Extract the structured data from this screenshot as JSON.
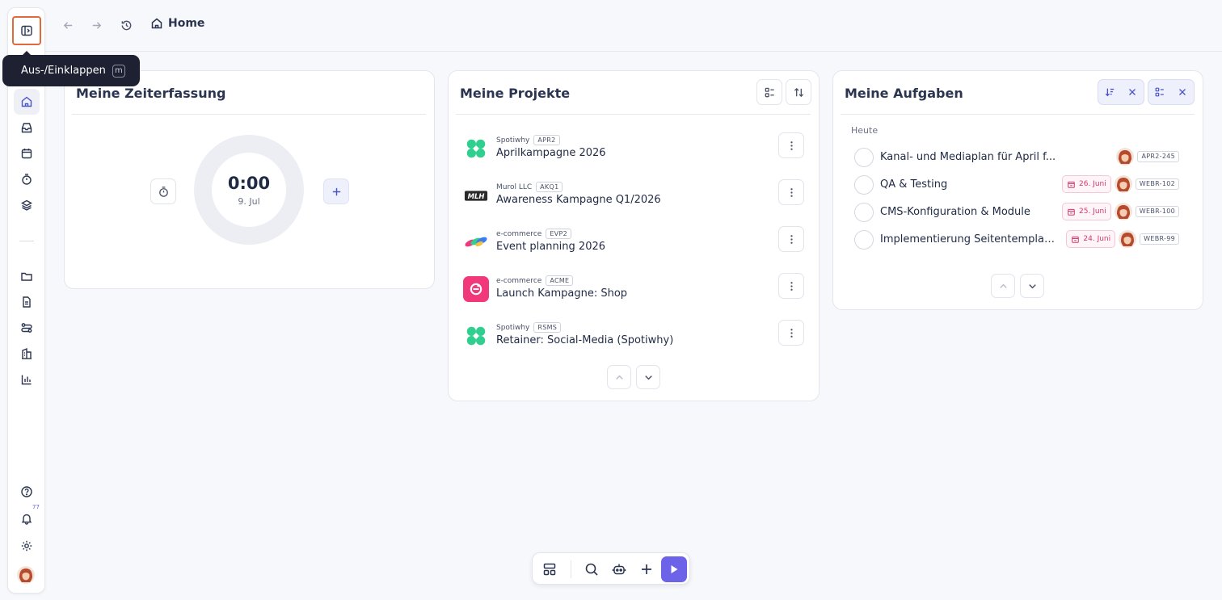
{
  "tooltip": {
    "label": "Aus-/Einklappen",
    "shortcut": "m"
  },
  "breadcrumb": {
    "label": "Home"
  },
  "sidebar": {
    "notification_count": "77"
  },
  "time_card": {
    "title": "Meine Zeiterfassung",
    "time": "0:00",
    "date": "9. Jul"
  },
  "projects_card": {
    "title": "Meine Projekte",
    "items": [
      {
        "client": "Spotiwhy",
        "code": "APR2",
        "name": "Aprilkampagne 2026",
        "logo": "spotiwhy-logo"
      },
      {
        "client": "Murol LLC",
        "code": "AKQ1",
        "name": "Awareness Kampagne Q1/2026",
        "logo": "murol-logo"
      },
      {
        "client": "e-commerce",
        "code": "EVP2",
        "name": "Event planning 2026",
        "logo": "ecommerce-logo"
      },
      {
        "client": "e-commerce",
        "code": "ACME",
        "name": "Launch Kampagne: Shop",
        "logo": "acme-logo"
      },
      {
        "client": "Spotiwhy",
        "code": "RSMS",
        "name": "Retainer: Social-Media (Spotiwhy)",
        "logo": "spotiwhy-logo"
      }
    ]
  },
  "tasks_card": {
    "title": "Meine Aufgaben",
    "section": "Heute",
    "items": [
      {
        "name": "Kanal- und Mediaplan für April f...",
        "date": "",
        "code": "APR2-245"
      },
      {
        "name": "QA & Testing",
        "date": "26. Juni",
        "code": "WEBR-102"
      },
      {
        "name": "CMS-Konfiguration & Module",
        "date": "25. Juni",
        "code": "WEBR-100"
      },
      {
        "name": "Implementierung Seitentemplates",
        "date": "24. Juni",
        "code": "WEBR-99"
      }
    ]
  },
  "colors": {
    "accent": "#6c63e8",
    "overdue": "#d23a6a",
    "spotiwhy": "#2ecf8f",
    "acme": "#f0387a"
  }
}
